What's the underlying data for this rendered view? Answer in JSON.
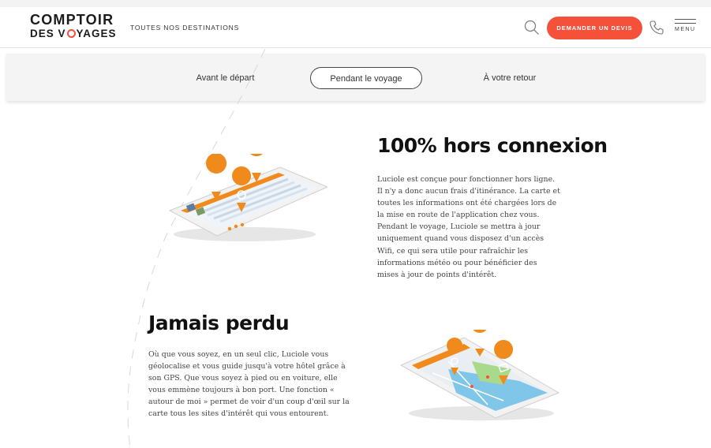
{
  "header": {
    "logo_line1": "COMPTOIR",
    "logo_line2_prefix": "DES V",
    "logo_line2_suffix": "YAGES",
    "nav_destinations": "TOUTES NOS DESTINATIONS",
    "cta_label": "DEMANDER UN DEVIS",
    "menu_label": "MENU",
    "icons": [
      "search-icon",
      "phone-icon",
      "hamburger-icon"
    ]
  },
  "tabs": [
    {
      "label": "Avant le départ",
      "active": false
    },
    {
      "label": "Pendant le voyage",
      "active": true
    },
    {
      "label": "À votre retour",
      "active": false
    }
  ],
  "sections": [
    {
      "title": "100% hors connexion",
      "lines": [
        "Luciole est conçue pour fonctionner hors ligne.",
        "Il n'y a donc aucun frais d'itinérance. La carte et",
        "toutes les informations ont été chargées lors de",
        "la mise en route de l'application chez vous.",
        "Pendant le voyage, Luciole se mettra à jour",
        "uniquement quand vous disposez d'un accès",
        "Wifi, ce qui sera utile pour rafraîchir les",
        "informations météo ou pour bénéficier des",
        "mises à jour de points d'intérêt."
      ]
    },
    {
      "title": "Jamais perdu",
      "lines": [
        "Où que vous soyez, en un seul clic, Luciole vous",
        "géolocalise et vous guide jusqu'à votre hôtel grâce à",
        "son GPS. Que vous soyez à pied ou en voiture, elle",
        "vous emmène toujours à bon port. Une fonction «",
        "autour de moi » permet de voir d'un coup d'œil sur la",
        "carte tous les sites d'intérêt qui vous entourent."
      ]
    }
  ],
  "colors": {
    "brand_accent": "#f4503a",
    "pin_orange": "#f08a1c",
    "tab_bar_bg": "#f4f4f4",
    "text_dark": "#111111",
    "text_body": "#444444"
  }
}
